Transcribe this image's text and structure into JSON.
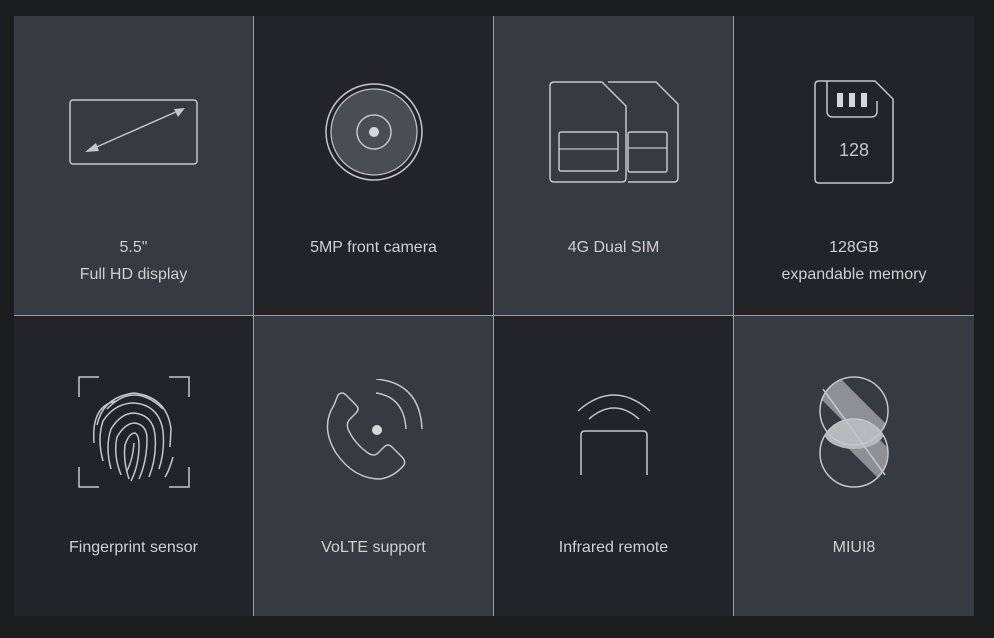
{
  "features": [
    {
      "lines": [
        "5.5\"",
        "Full HD display"
      ],
      "icon": "display-icon"
    },
    {
      "lines": [
        "5MP front camera"
      ],
      "icon": "camera-icon"
    },
    {
      "lines": [
        "4G Dual SIM"
      ],
      "icon": "dual-sim-icon"
    },
    {
      "lines": [
        "128GB",
        "expandable memory"
      ],
      "icon": "sd-card-icon",
      "icon_text": "128"
    },
    {
      "lines": [
        "Fingerprint sensor"
      ],
      "icon": "fingerprint-icon"
    },
    {
      "lines": [
        "VoLTE support"
      ],
      "icon": "volte-phone-icon"
    },
    {
      "lines": [
        "Infrared remote"
      ],
      "icon": "infrared-icon"
    },
    {
      "lines": [
        "MIUI8"
      ],
      "icon": "miui8-logo"
    }
  ],
  "colors": {
    "light_tile": "#363a41",
    "dark_tile": "#232428",
    "icon_stroke": "#c4c6ca",
    "text": "#cfd0d2"
  }
}
